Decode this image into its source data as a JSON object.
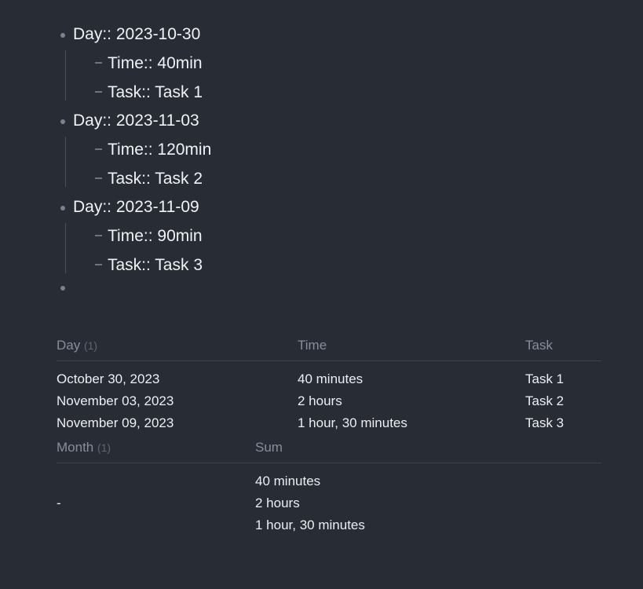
{
  "theme": {
    "background": "#282c35",
    "text": "#eceef2",
    "muted_text": "#868d9c",
    "dim_text": "#5f6674",
    "rule": "#3e434f",
    "bullet": "#7b8191",
    "guide_line": "#4a4f5c"
  },
  "outline": {
    "groups": [
      {
        "day": "Day:: 2023-10-30",
        "children": [
          {
            "text": "Time:: 40min"
          },
          {
            "text": "Task:: Task 1"
          }
        ]
      },
      {
        "day": "Day:: 2023-11-03",
        "children": [
          {
            "text": "Time:: 120min"
          },
          {
            "text": "Task:: Task 2"
          }
        ]
      },
      {
        "day": "Day:: 2023-11-09",
        "children": [
          {
            "text": "Time:: 90min"
          },
          {
            "text": "Task:: Task 3"
          }
        ]
      }
    ],
    "trailing_empty_bullet": ""
  },
  "table_day": {
    "headers": {
      "day": "Day",
      "day_count": "(1)",
      "time": "Time",
      "task": "Task"
    },
    "rows": [
      {
        "day": "October 30, 2023",
        "time": "40 minutes",
        "task": "Task 1"
      },
      {
        "day": "November 03, 2023",
        "time": "2 hours",
        "task": "Task 2"
      },
      {
        "day": "November 09, 2023",
        "time": "1 hour, 30 minutes",
        "task": "Task 3"
      }
    ]
  },
  "table_month": {
    "headers": {
      "month": "Month",
      "month_count": "(1)",
      "sum": "Sum"
    },
    "rows": [
      {
        "month": "-",
        "sum_lines": [
          "40 minutes",
          "2 hours",
          "1 hour, 30 minutes"
        ]
      }
    ]
  }
}
